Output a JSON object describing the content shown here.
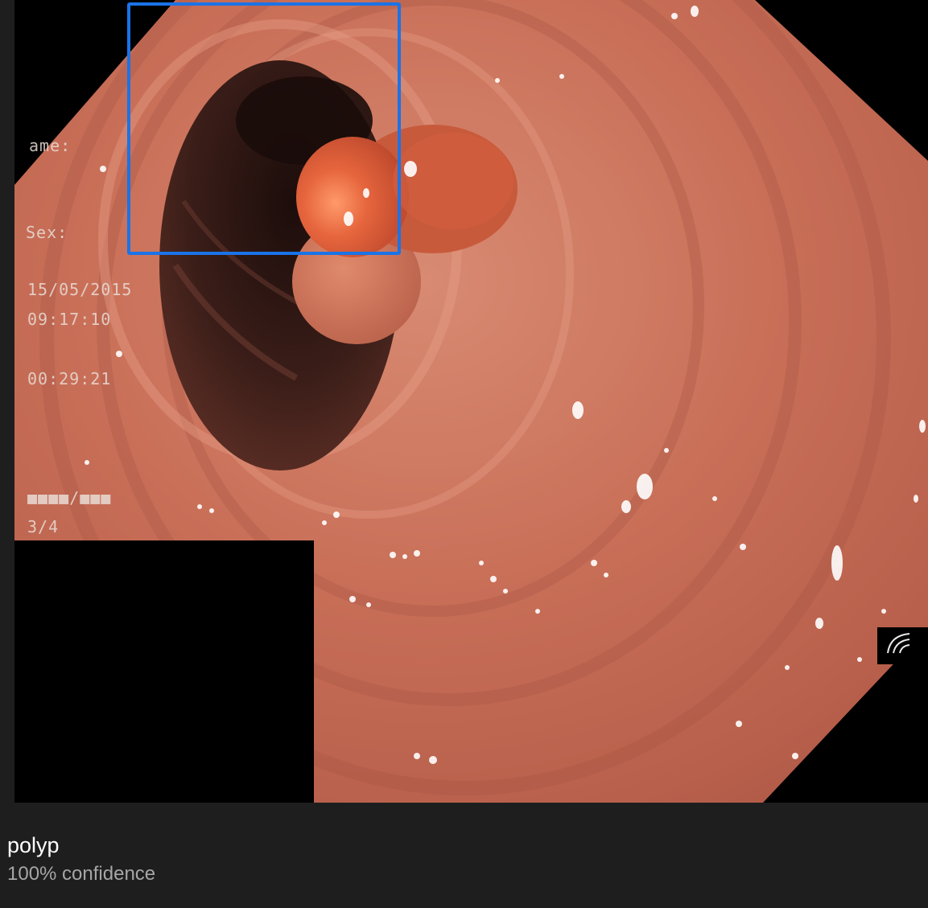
{
  "osd": {
    "name_label": "ame:",
    "sex_label": "Sex:",
    "date": "15/05/2015",
    "time": "09:17:10",
    "elapsed": "00:29:21",
    "masked_id": "■■■■/■■■",
    "page": "3/4"
  },
  "detection": {
    "label": "polyp",
    "confidence_text": "100% confidence",
    "confidence": 1.0,
    "box_color": "#1a73e8"
  },
  "colors": {
    "background": "#1e1e1e",
    "tissue": "#c9705c",
    "lumen": "#2a1412",
    "polyp": "#e0633d"
  }
}
